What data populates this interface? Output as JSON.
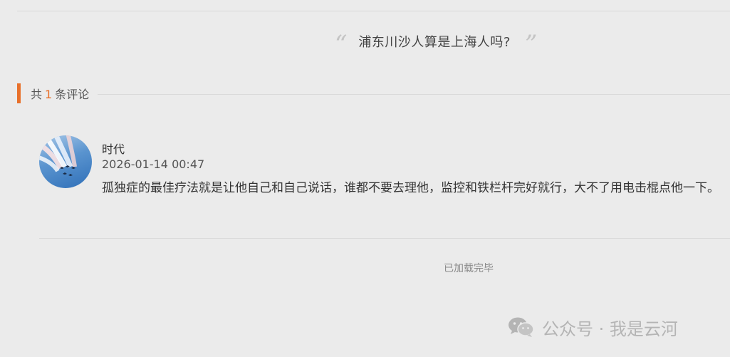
{
  "article": {
    "quote_open": "“",
    "quote_text": "浦东川沙人算是上海人吗?",
    "quote_close": "”"
  },
  "comments_section": {
    "prefix": "共",
    "count": "1",
    "suffix": "条评论",
    "accent_color": "#e8702a"
  },
  "comments": [
    {
      "author": "时代",
      "time": "2026-01-14 00:47",
      "text": "孤独症的最佳疗法就是让他自己和自己说话，谁都不要去理他，监控和铁栏杆完好就行，大不了用电击棍点他一下。",
      "avatar_icon": "airshow-jets-avatar"
    }
  ],
  "load_status": "已加载完毕",
  "watermark": {
    "icon": "wechat-icon",
    "text": "公众号 · 我是云河"
  }
}
